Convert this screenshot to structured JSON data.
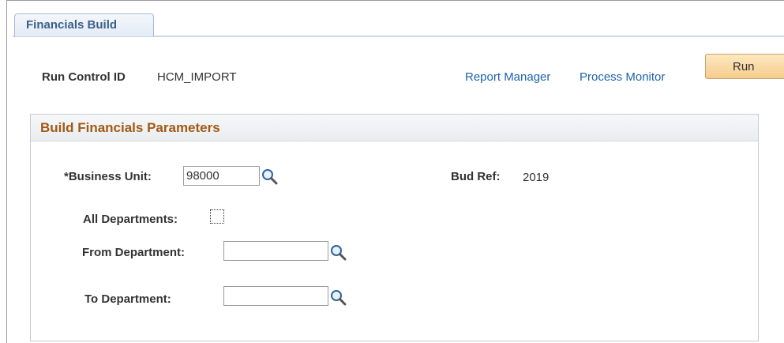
{
  "tab": {
    "label": "Financials Build"
  },
  "run_control": {
    "label": "Run Control ID",
    "value": "HCM_IMPORT"
  },
  "links": {
    "report_manager": "Report Manager",
    "process_monitor": "Process Monitor"
  },
  "run_button": {
    "label": "Run"
  },
  "group": {
    "title": "Build Financials Parameters",
    "business_unit": {
      "label": "*Business Unit:",
      "value": "98000"
    },
    "bud_ref": {
      "label": "Bud Ref:",
      "value": "2019"
    },
    "all_departments": {
      "label": "All Departments:",
      "checked": false
    },
    "from_department": {
      "label": "From Department:",
      "value": ""
    },
    "to_department": {
      "label": "To Department:",
      "value": ""
    }
  },
  "icons": {
    "lookup": "magnifier-lookup-icon",
    "checkbox": "checkbox-unchecked"
  },
  "colors": {
    "accent_link": "#2163a8",
    "group_title": "#a05a13",
    "tab_text": "#3b5f8a",
    "button_bg": "#f6cc8d"
  }
}
